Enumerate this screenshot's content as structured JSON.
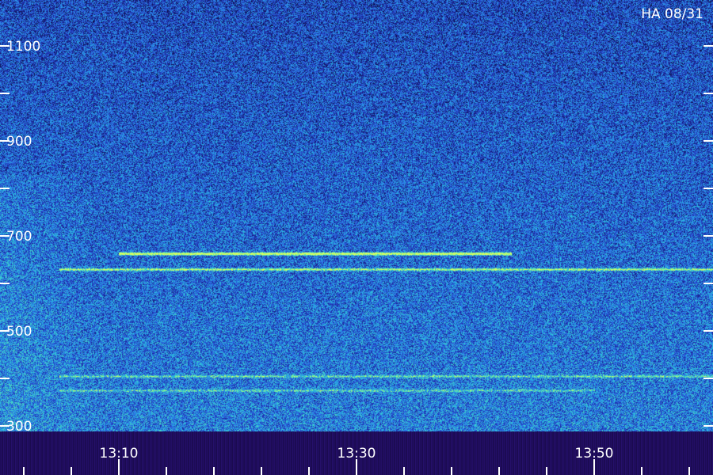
{
  "chart_data": {
    "type": "heatmap",
    "title": "HA 08/31",
    "y_tick_labels": [
      "1100",
      "900",
      "700",
      "500",
      "300"
    ],
    "y_ticks": [
      1100,
      1000,
      900,
      800,
      700,
      600,
      500,
      400,
      300
    ],
    "ylim": [
      300,
      1200
    ],
    "x_tick_labels": [
      "13:10",
      "13:30",
      "13:50"
    ],
    "x_major_ticks": [
      "13:10",
      "13:30",
      "13:50"
    ],
    "x_minor_ticks": [
      "13:02",
      "13:06",
      "13:14",
      "13:18",
      "13:22",
      "13:26",
      "13:34",
      "13:38",
      "13:42",
      "13:46",
      "13:54",
      "13:58"
    ],
    "xlim": [
      "13:05",
      "14:05"
    ],
    "bands": [
      {
        "y": 663,
        "x_start": "13:10",
        "x_end": "13:43",
        "intensity": 0.95
      },
      {
        "y": 630,
        "x_start": "13:05",
        "x_end": "14:05",
        "intensity": 0.6
      },
      {
        "y": 405,
        "x_start": "13:05",
        "x_end": "14:05",
        "intensity": 0.35
      },
      {
        "y": 375,
        "x_start": "13:05",
        "x_end": "13:50",
        "intensity": 0.3
      }
    ],
    "colorscale": [
      "#0a0a3a",
      "#1f2fae",
      "#2d6ee6",
      "#27b9e0",
      "#6ff0a0",
      "#d8ff60"
    ]
  }
}
